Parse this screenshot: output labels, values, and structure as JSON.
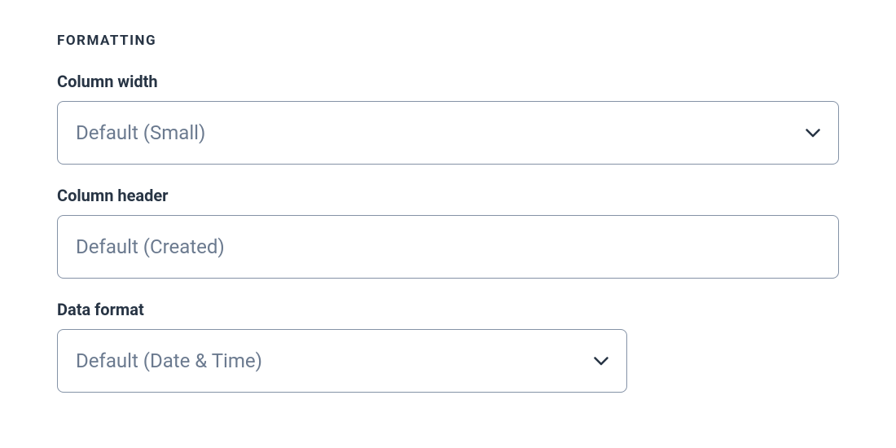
{
  "section": {
    "header": "FORMATTING"
  },
  "fields": {
    "columnWidth": {
      "label": "Column width",
      "value": "Default (Small)"
    },
    "columnHeader": {
      "label": "Column header",
      "placeholder": "Default (Created)",
      "value": ""
    },
    "dataFormat": {
      "label": "Data format",
      "value": "Default (Date & Time)"
    }
  }
}
